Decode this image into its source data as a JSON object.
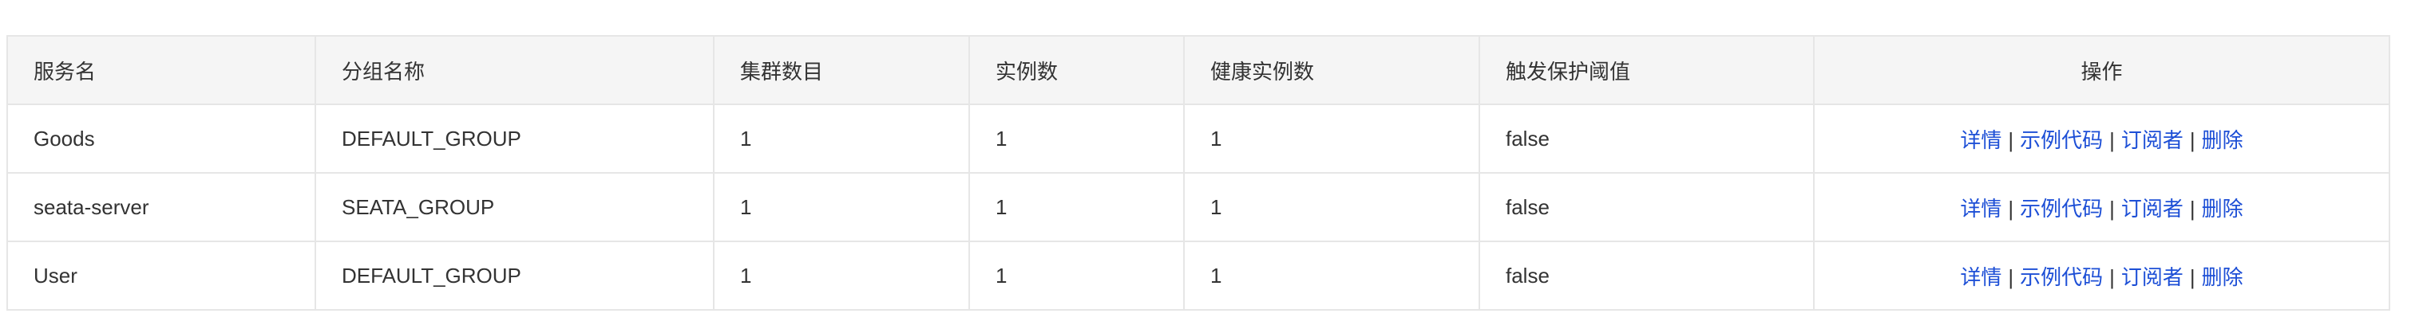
{
  "table": {
    "headers": [
      "服务名",
      "分组名称",
      "集群数目",
      "实例数",
      "健康实例数",
      "触发保护阈值",
      "操作"
    ],
    "rows": [
      {
        "service": "Goods",
        "group": "DEFAULT_GROUP",
        "clusters": "1",
        "instances": "1",
        "healthy": "1",
        "protect": "false"
      },
      {
        "service": "seata-server",
        "group": "SEATA_GROUP",
        "clusters": "1",
        "instances": "1",
        "healthy": "1",
        "protect": "false"
      },
      {
        "service": "User",
        "group": "DEFAULT_GROUP",
        "clusters": "1",
        "instances": "1",
        "healthy": "1",
        "protect": "false"
      }
    ],
    "actions": {
      "detail": "详情",
      "sample_code": "示例代码",
      "subscribers": "订阅者",
      "delete": "删除",
      "separator": "|"
    }
  },
  "colors": {
    "link": "#1d4fd6",
    "header_bg": "#f5f5f5",
    "border": "#e6e6e6"
  }
}
